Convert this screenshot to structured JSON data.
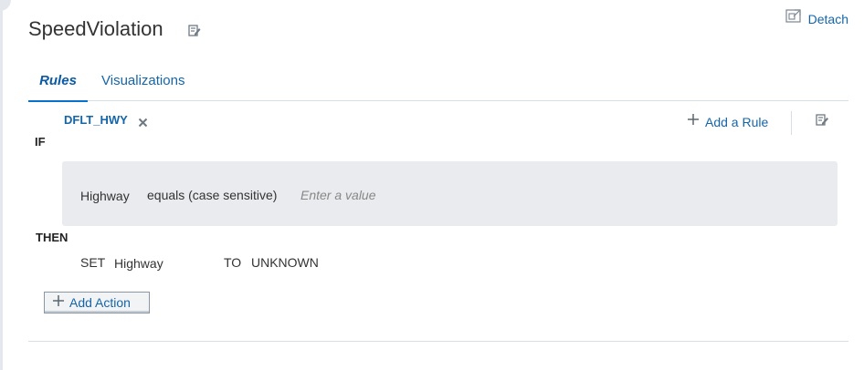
{
  "header": {
    "title": "SpeedViolation",
    "detach_label": "Detach"
  },
  "tabs": [
    {
      "label": "Rules",
      "active": true
    },
    {
      "label": "Visualizations",
      "active": false
    }
  ],
  "rule": {
    "name": "DFLT_HWY",
    "add_rule_label": "Add a Rule",
    "if_label": "IF",
    "then_label": "THEN",
    "condition": {
      "field": "Highway",
      "operator": "equals (case sensitive)",
      "value": "",
      "placeholder": "Enter a value"
    },
    "action": {
      "set_label": "SET",
      "field": "Highway",
      "to_label": "TO",
      "value": "UNKNOWN"
    },
    "add_action_label": "Add Action"
  },
  "colors": {
    "link": "#1565a9",
    "tab_underline": "#0572ce",
    "condition_bg": "#e9ebee",
    "divider": "#d6dfe6"
  },
  "icons": [
    "edit-icon",
    "detach-icon",
    "close-icon",
    "plus-icon"
  ]
}
